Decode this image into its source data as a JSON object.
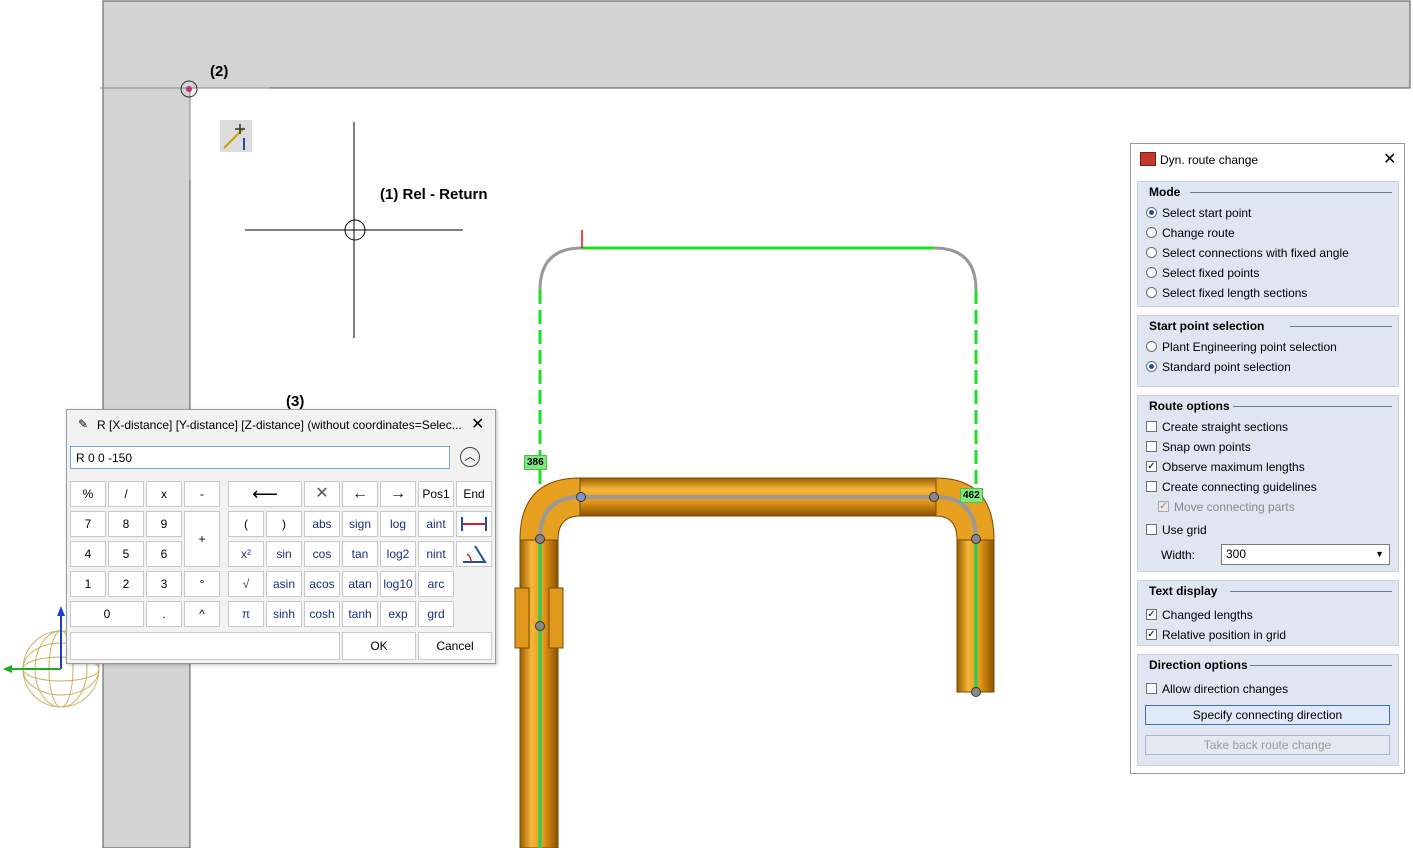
{
  "annotations": {
    "label_2": "(2)",
    "label_1": "(1) Rel - Return",
    "label_3": "(3)",
    "dim_left": "386",
    "dim_right": "462"
  },
  "calculator": {
    "title": "R [X-distance] [Y-distance] [Z-distance] (without coordinates=Selec...",
    "input_value": "R 0 0 -150",
    "keys": {
      "percent": "%",
      "slash": "/",
      "times": "x",
      "minus": "-",
      "seven": "7",
      "eight": "8",
      "nine": "9",
      "plus": "+",
      "four": "4",
      "five": "5",
      "six": "6",
      "one": "1",
      "two": "2",
      "three": "3",
      "degree": "°",
      "zero": "0",
      "dot": ".",
      "caret": "^",
      "backspace": "⟵",
      "clear": "✕",
      "left": "←",
      "right": "→",
      "pos1": "Pos1",
      "end": "End",
      "lparen": "(",
      "rparen": ")",
      "abs": "abs",
      "sign": "sign",
      "log": "log",
      "aint": "aint",
      "square": "x²",
      "sin": "sin",
      "cos": "cos",
      "tan": "tan",
      "log2": "log2",
      "nint": "nint",
      "sqrt": "√",
      "asin": "asin",
      "acos": "acos",
      "atan": "atan",
      "log10": "log10",
      "arc": "arc",
      "pi": "π",
      "sinh": "sinh",
      "cosh": "cosh",
      "tanh": "tanh",
      "exp": "exp",
      "grd": "grd"
    },
    "ok_label": "OK",
    "cancel_label": "Cancel"
  },
  "panel": {
    "title": "Dyn. route change",
    "mode": {
      "heading": "Mode",
      "options": [
        "Select start point",
        "Change route",
        "Select connections with fixed angle",
        "Select fixed points",
        "Select fixed length sections"
      ],
      "selected_index": 0
    },
    "start_point": {
      "heading": "Start point selection",
      "options": [
        "Plant Engineering point selection",
        "Standard point selection"
      ],
      "selected_index": 1
    },
    "route_options": {
      "heading": "Route options",
      "create_straight": "Create straight sections",
      "snap_own": "Snap own points",
      "observe_max": "Observe maximum lengths",
      "create_guidelines": "Create connecting guidelines",
      "move_parts": "Move connecting parts",
      "use_grid": "Use grid",
      "width_label": "Width:",
      "width_value": "300"
    },
    "text_display": {
      "heading": "Text display",
      "changed_lengths": "Changed lengths",
      "relative_position": "Relative position in grid"
    },
    "direction": {
      "heading": "Direction options",
      "allow_changes": "Allow direction changes",
      "specify_button": "Specify connecting direction",
      "take_back_button": "Take back route change"
    }
  },
  "colors": {
    "pipe": "#e8a020",
    "route_green": "#22dd22",
    "panel_group_bg": "#dfe6f1",
    "wall_gray": "#d3d3d3"
  }
}
